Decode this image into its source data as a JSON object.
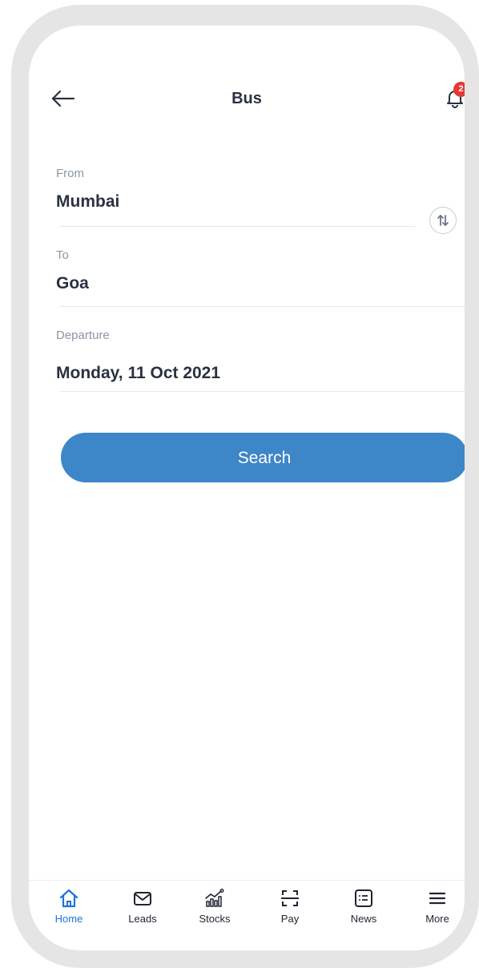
{
  "header": {
    "title": "Bus",
    "notification_count": "2"
  },
  "form": {
    "from_label": "From",
    "from_value": "Mumbai",
    "to_label": "To",
    "to_value": "Goa",
    "departure_label": "Departure",
    "departure_value": "Monday, 11 Oct 2021",
    "search_label": "Search"
  },
  "nav": {
    "items": [
      {
        "label": "Home",
        "icon": "home-icon",
        "active": true
      },
      {
        "label": "Leads",
        "icon": "mail-icon",
        "active": false
      },
      {
        "label": "Stocks",
        "icon": "stocks-chart-icon",
        "active": false
      },
      {
        "label": "Pay",
        "icon": "scan-icon",
        "active": false
      },
      {
        "label": "News",
        "icon": "news-list-icon",
        "active": false
      },
      {
        "label": "More",
        "icon": "menu-icon",
        "active": false
      }
    ]
  },
  "colors": {
    "accent": "#3d86c8",
    "active_nav": "#1e73d8",
    "badge": "#e53935"
  }
}
